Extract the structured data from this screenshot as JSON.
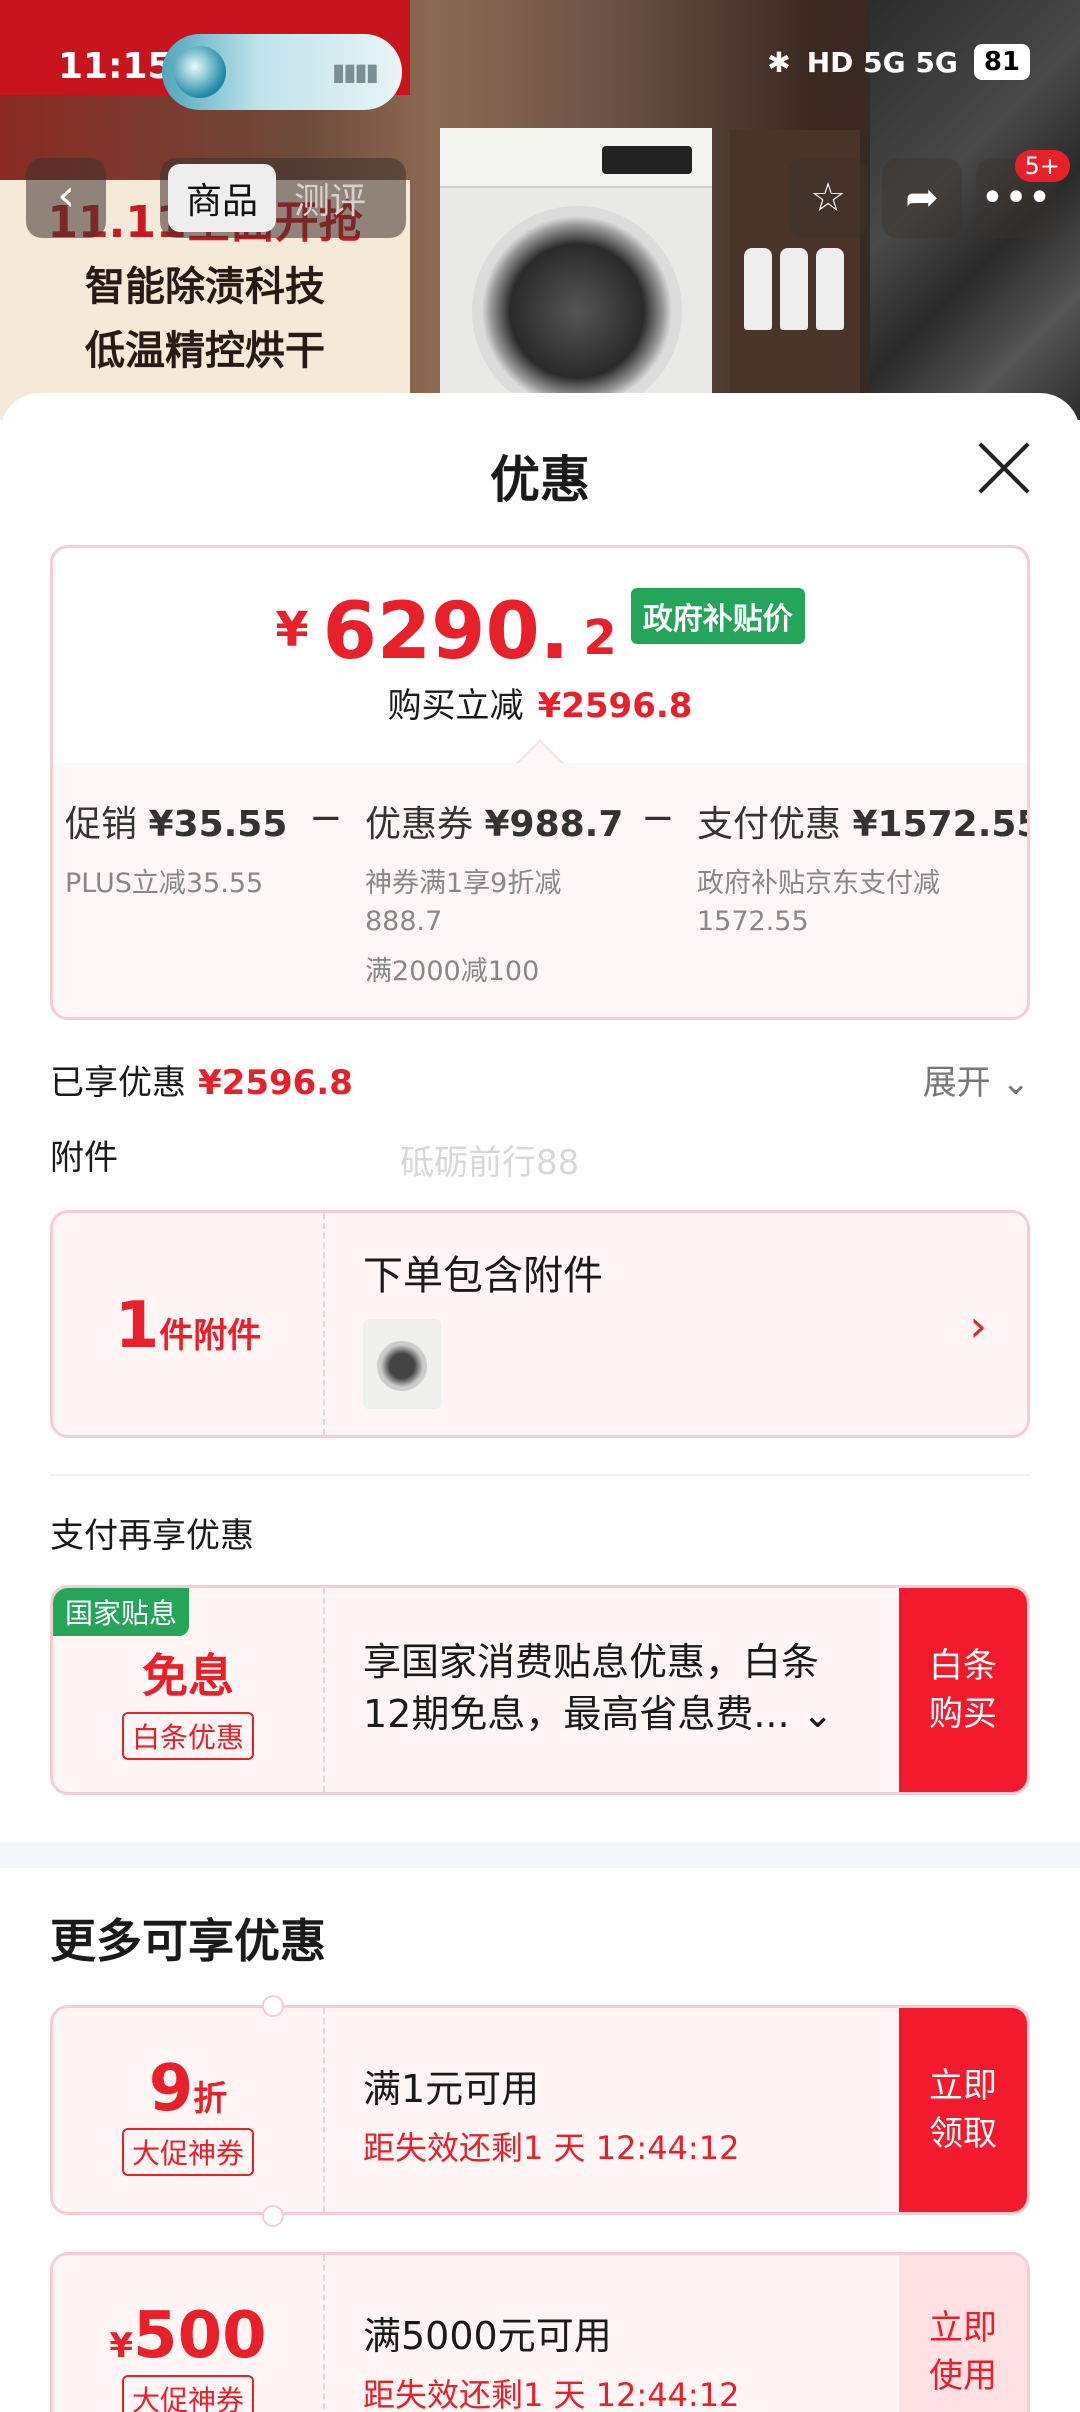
{
  "status_bar": {
    "time": "11:15",
    "battery": "81",
    "network": "HD 5G 5G",
    "notification_badge": "5+"
  },
  "product_banner": {
    "promo_line1": "11.11全面开抢",
    "promo_line2": "智能除渍科技",
    "promo_line3": "低温精控烘干"
  },
  "nav": {
    "tabs": [
      "商品",
      "测评"
    ],
    "active_tab": "商品"
  },
  "sheet": {
    "title": "优惠"
  },
  "price": {
    "yen": "¥",
    "integer": "6290.",
    "decimal": "2",
    "gov_tag": "政府补贴价",
    "reduce_label": "购买立减",
    "reduce_value": "¥2596.8"
  },
  "breakdown": [
    {
      "label": "促销",
      "value": "¥35.55",
      "desc": [
        "PLUS立减35.55"
      ]
    },
    {
      "label": "优惠券",
      "value": "¥988.7",
      "desc": [
        "神券满1享9折减",
        "888.7",
        "满2000减100"
      ]
    },
    {
      "label": "支付优惠",
      "value": "¥1572.55",
      "desc": [
        "政府补贴京东支付减",
        "1572.55"
      ]
    }
  ],
  "breakdown_op": "−",
  "enjoyed": {
    "label": "已享优惠",
    "value": "¥2596.8",
    "expand": "展开"
  },
  "watermark": "砥砺前行88",
  "accessory": {
    "section_label": "附件",
    "count": "1",
    "count_unit": "件附件",
    "title": "下单包含附件",
    "arrow": "›"
  },
  "pay_section": {
    "label": "支付再享优惠",
    "corner_tag": "国家贴息",
    "main": "免息",
    "sub_tag": "白条优惠",
    "desc_line1": "享国家消费贴息优惠，白条",
    "desc_line2": "12期免息，最高省息费...",
    "action": "白条购买"
  },
  "more": {
    "title": "更多可享优惠",
    "coupons": [
      {
        "amount": "9",
        "unit": "折",
        "prefix": "",
        "tag": "大促神券",
        "condition": "满1元可用",
        "expiry": "距失效还剩1 天 12:44:12",
        "action": "立即领取"
      },
      {
        "amount": "500",
        "unit": "",
        "prefix": "¥",
        "tag": "大促神券",
        "condition": "满5000元可用",
        "expiry": "距失效还剩1 天 12:44:12",
        "action": "立即使用"
      }
    ]
  },
  "colors": {
    "accent": "#e8202a",
    "green_tag": "#25a55a",
    "card_border": "#f6cdd2",
    "card_bg": "#fff5f5"
  }
}
